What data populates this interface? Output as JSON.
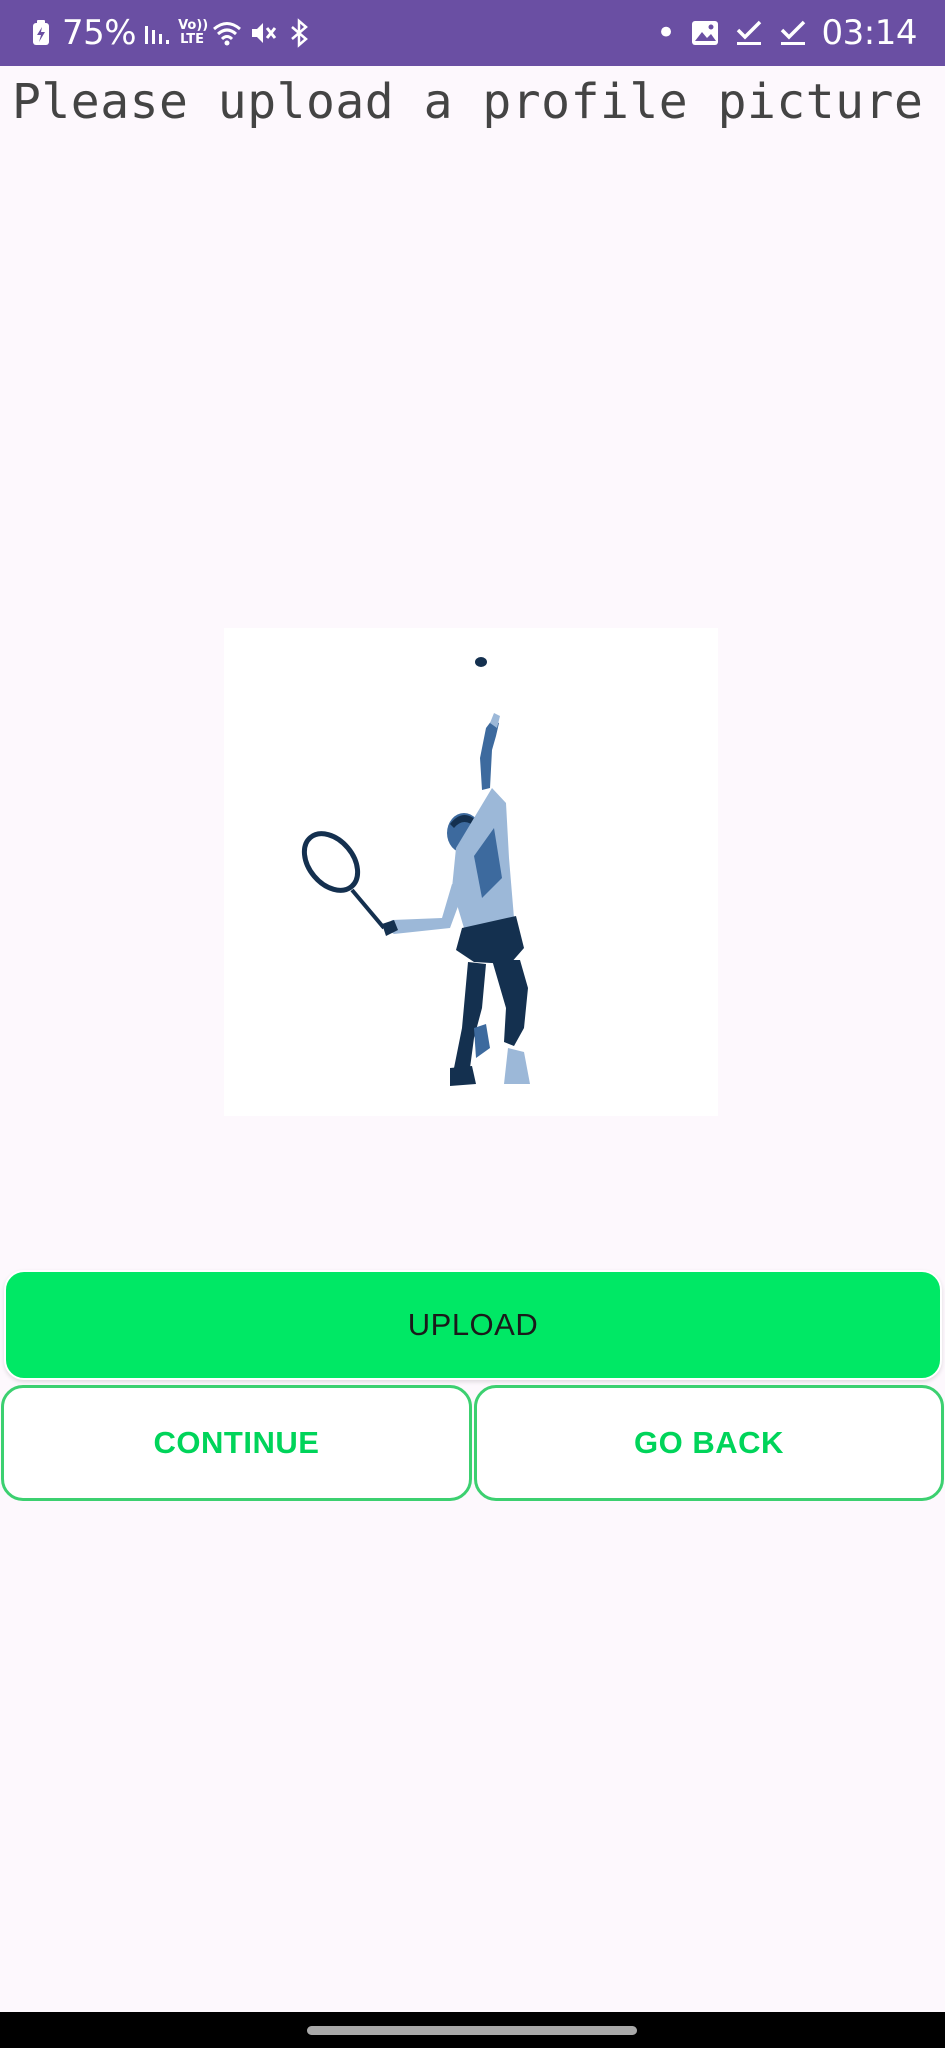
{
  "status_bar": {
    "battery": "75%",
    "volte_top": "Vo))",
    "volte_bottom": "LTE",
    "time": "03:14",
    "dot": "•",
    "icons": [
      "battery-charging-icon",
      "signal-icon",
      "volte-icon",
      "wifi-icon",
      "mute-icon",
      "bluetooth-icon",
      "notification-dot-icon",
      "image-icon",
      "check-icon",
      "check-icon",
      "clock"
    ]
  },
  "prompt": {
    "text": "Please upload a profile picture"
  },
  "profile_picture": {
    "subject": "tennis-player-silhouette",
    "colors": {
      "dark": "#14304f",
      "mid": "#3d6a9e",
      "light": "#9cb8d8"
    }
  },
  "buttons": {
    "upload_label": "UPLOAD",
    "continue_label": "CONTINUE",
    "go_back_label": "GO BACK"
  },
  "theme": {
    "status_bar_color": "#6a4fa3",
    "accent_green": "#00e865",
    "outline_green": "#3cd070",
    "background": "#fdf8fd"
  }
}
